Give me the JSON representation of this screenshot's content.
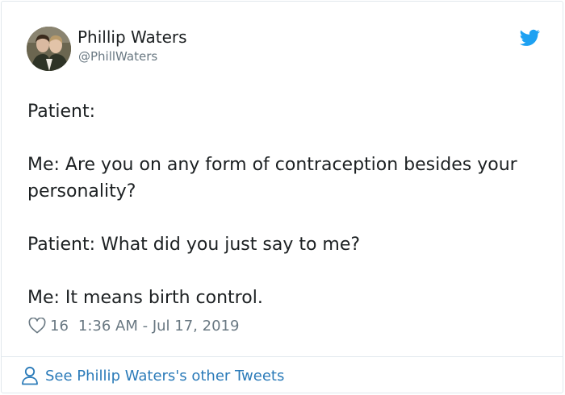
{
  "author": {
    "display_name": "Phillip Waters",
    "handle": "@PhillWaters"
  },
  "tweet": {
    "lines": [
      "Patient:",
      "Me: Are you on any form of contraception besides your personality?",
      "Patient: What did you just say to me?",
      "Me: It means birth control."
    ]
  },
  "meta": {
    "like_count": "16",
    "timestamp": "1:36 AM - Jul 17, 2019"
  },
  "footer": {
    "link_text": "See Phillip Waters's other Tweets"
  },
  "colors": {
    "twitter_blue": "#1da1f2",
    "link": "#2b7bb9",
    "text": "#1c2022",
    "muted": "#697882",
    "border": "#e1e8ed"
  },
  "icons": [
    "twitter-bird-icon",
    "heart-icon",
    "person-icon"
  ]
}
